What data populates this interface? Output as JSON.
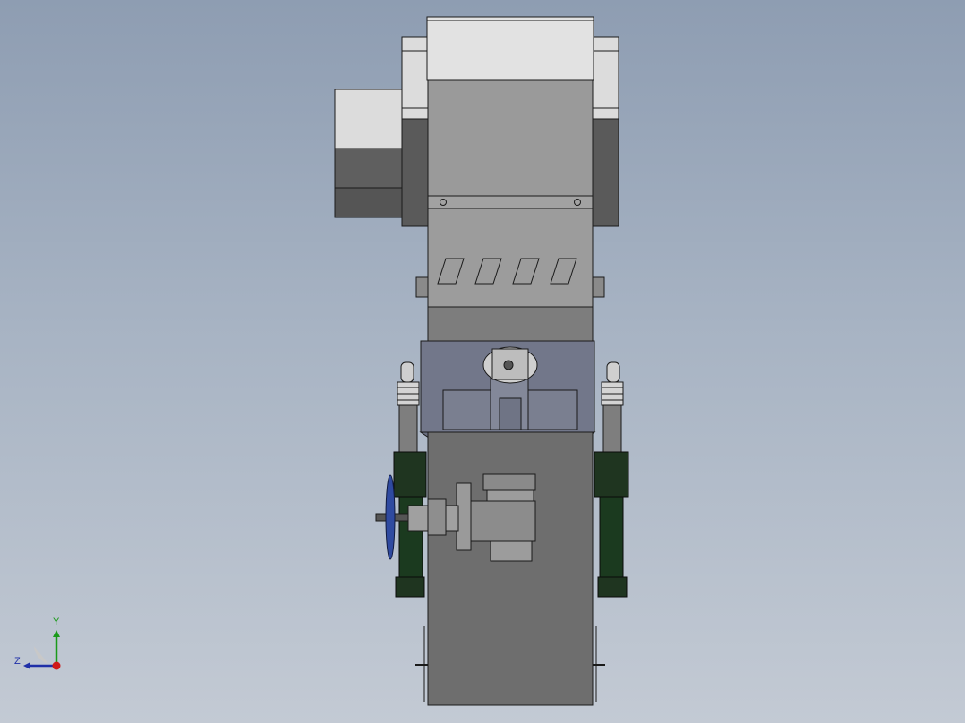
{
  "viewport": {
    "background_top": "#8e9db2",
    "background_bottom": "#c3cad4"
  },
  "model": {
    "colors": {
      "light_panel": "#dcdcdc",
      "mid_gray": "#999999",
      "dark_gray": "#5f5f5f",
      "body_gray": "#6e6e6e",
      "hopper_blue_gray": "#72778a",
      "green_cylinder": "#1f3520",
      "handwheel_blue": "#2f4aa0",
      "outline": "#1a1a1a"
    }
  },
  "triad": {
    "y_label": "Y",
    "z_label": "Z",
    "y_color": "#1a9a1a",
    "z_color": "#1f2fa8",
    "x_color": "#d01818"
  }
}
